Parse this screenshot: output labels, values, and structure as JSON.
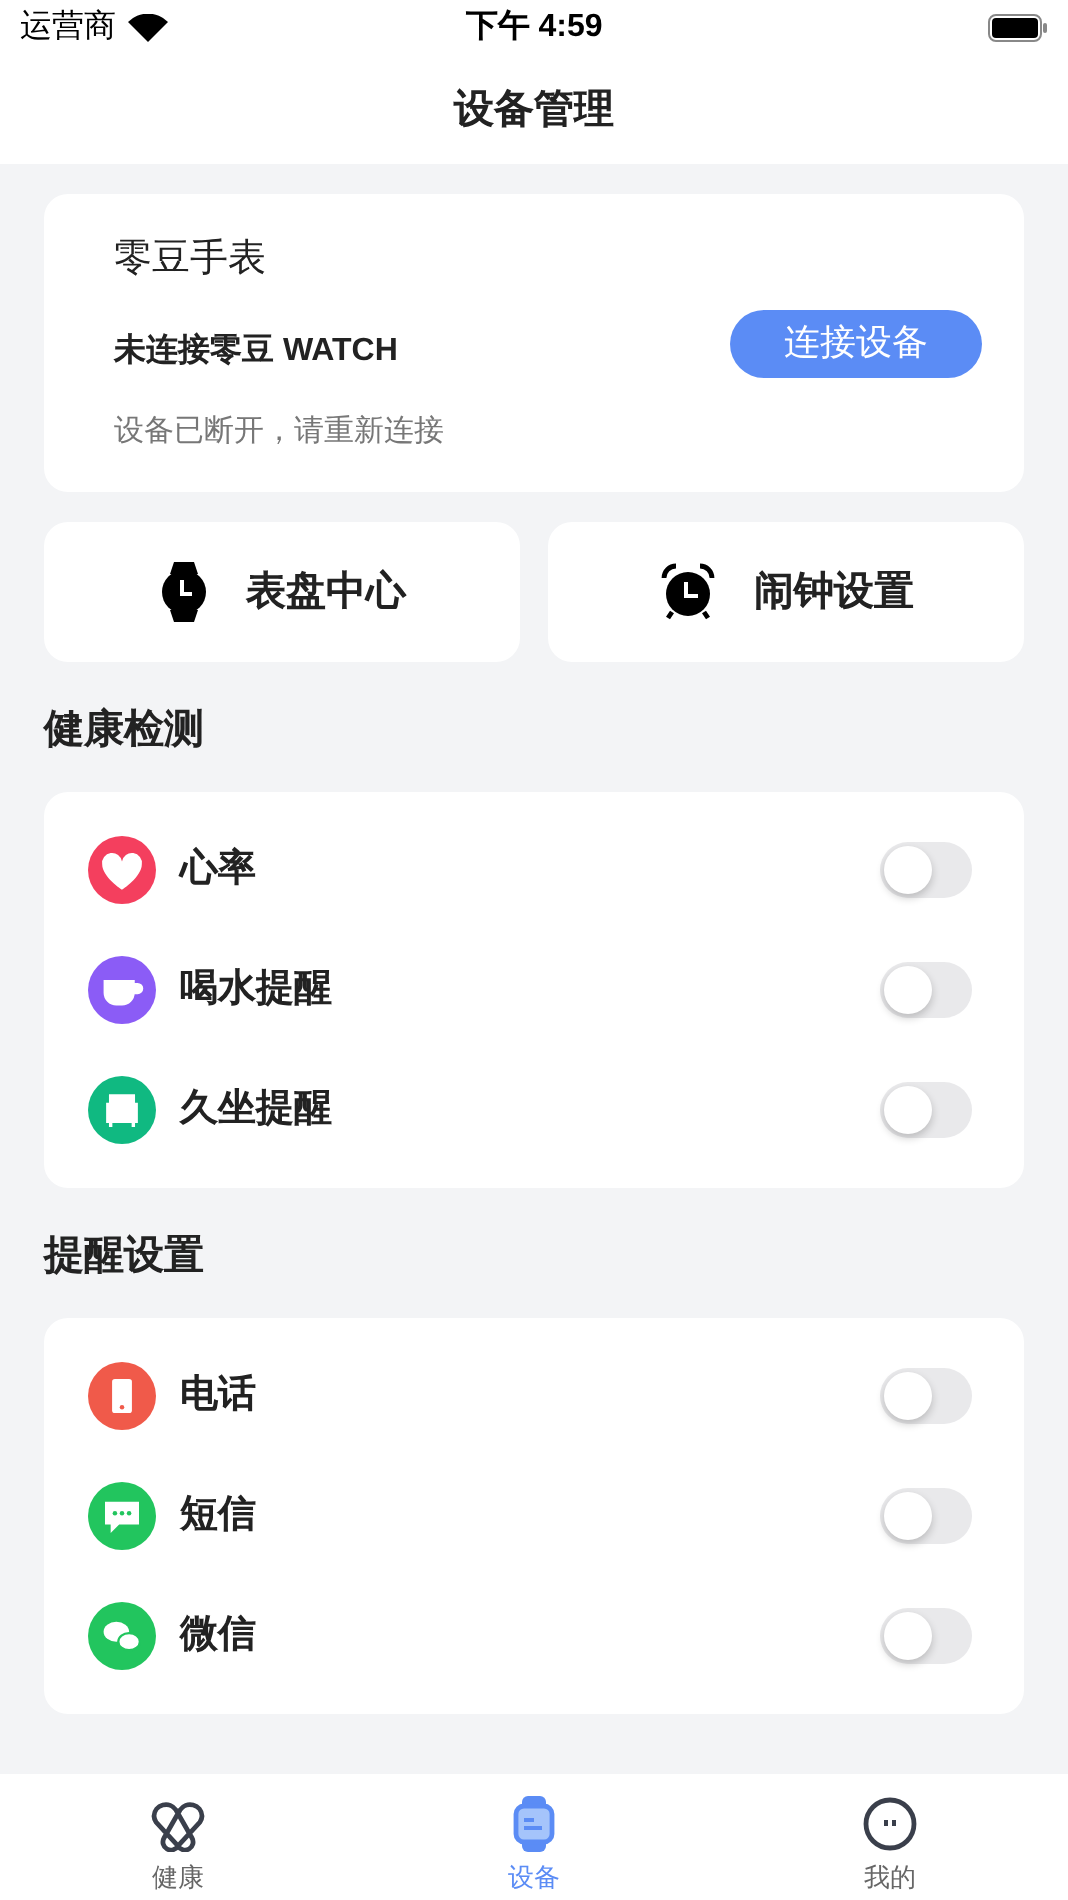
{
  "status_bar": {
    "carrier": "运营商",
    "time": "下午 4:59"
  },
  "nav": {
    "title": "设备管理"
  },
  "device": {
    "name": "零豆手表",
    "status": "未连接零豆 WATCH",
    "hint": "设备已断开，请重新连接",
    "button": "连接设备"
  },
  "shortcuts": [
    {
      "label": "表盘中心",
      "kind": "watch"
    },
    {
      "label": "闹钟设置",
      "kind": "alarm"
    }
  ],
  "sections": [
    {
      "title": "健康检测",
      "items": [
        {
          "label": "心率",
          "color": "#f43f5e",
          "on": false
        },
        {
          "label": "喝水提醒",
          "color": "#8b5cf6",
          "on": false
        },
        {
          "label": "久坐提醒",
          "color": "#10b981",
          "on": false
        }
      ]
    },
    {
      "title": "提醒设置",
      "items": [
        {
          "label": "电话",
          "color": "#f05a4a",
          "on": false
        },
        {
          "label": "短信",
          "color": "#22c55e",
          "on": false
        },
        {
          "label": "微信",
          "color": "#22c55e",
          "on": false
        }
      ]
    }
  ],
  "tab_bar": [
    {
      "label": "健康",
      "selected": false
    },
    {
      "label": "设备",
      "selected": true
    },
    {
      "label": "我的",
      "selected": false
    }
  ]
}
